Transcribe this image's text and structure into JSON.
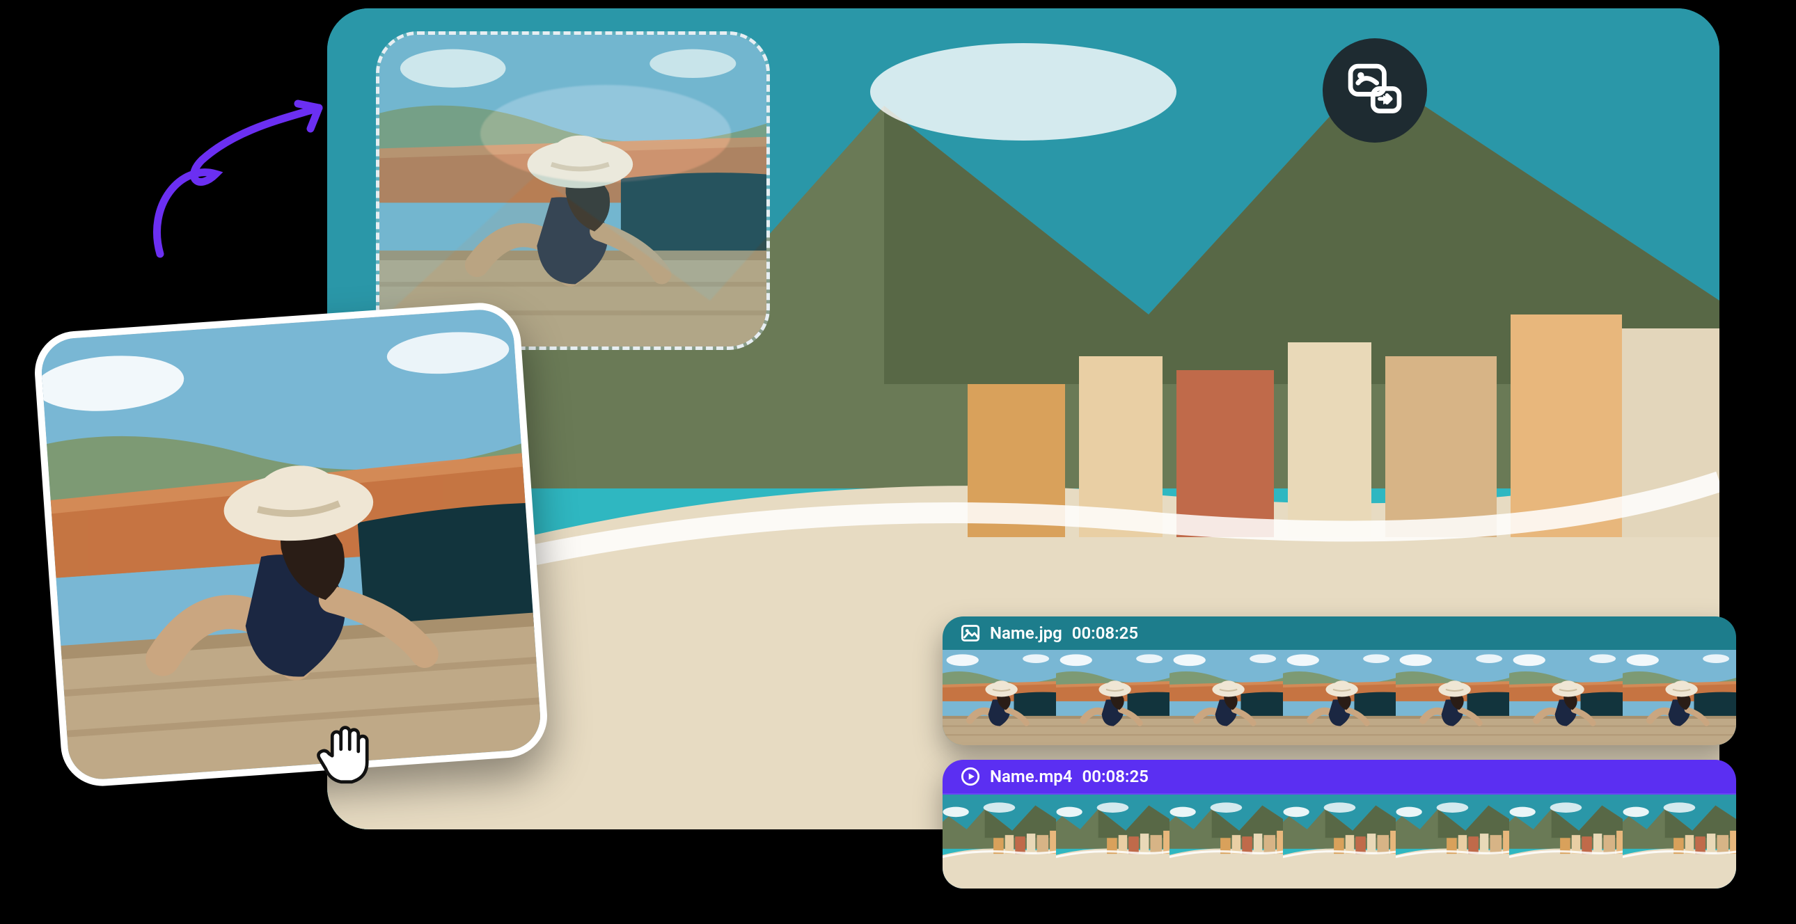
{
  "pip_button_name": "picture-in-picture",
  "tracks": [
    {
      "icon": "image-icon",
      "filename": "Name.jpg",
      "timestamp": "00:08:25",
      "accent": "#1d7d8c",
      "frames": 7,
      "thumb": "woman-overlook"
    },
    {
      "icon": "play-circle-icon",
      "filename": "Name.mp4",
      "timestamp": "00:08:25",
      "accent": "#5b2ff2",
      "frames": 7,
      "thumb": "beach-town"
    }
  ]
}
